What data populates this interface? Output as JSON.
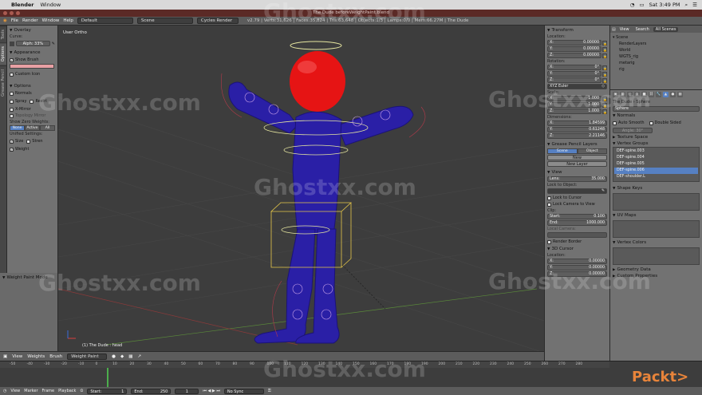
{
  "macos": {
    "app_name": "Blender",
    "menu": [
      "Window"
    ],
    "clock": "Sat 3:49 PM"
  },
  "window": {
    "title": "The Dude beforeWeightPaint.blend"
  },
  "infobar": {
    "menus": [
      "File",
      "Render",
      "Window",
      "Help"
    ],
    "layout": "Default",
    "scene": "Scene",
    "engine": "Cycles Render",
    "stats": "v2.79 | Verts:31,626 | Faces:35,824 | Tris:63,648 | Objects:1/3 | Lamps:0/0 | Mem:66.27M | The Dude"
  },
  "tooltabs": [
    "Tools",
    "Options",
    "Grease Pencil"
  ],
  "shelf": {
    "overlay_head": "Overlay",
    "curve_label": "Curve:",
    "alpha_field": "Alph: 33%",
    "appearance_head": "Appearance",
    "show_brush": "Show Brush",
    "custom_icon": "Custom Icon",
    "options_head": "Options",
    "opt_normals": "Normals",
    "opt_spray": "Spray",
    "opt_restrict": "Restri",
    "opt_xmirror": "X-Mirror",
    "opt_topology": "Topology Mirror",
    "zero_weights": "Show Zero Weights:",
    "zw_none": "None",
    "zw_active": "Active",
    "zw_all": "All",
    "unified": "Unified Settings:",
    "u_size": "Size",
    "u_strength": "Stren",
    "u_weight": "Weight",
    "mode_panel": "Weight Paint Mode"
  },
  "viewport": {
    "label": "User Ortho",
    "object_label": "(1) The Dude : head",
    "header": {
      "view": "View",
      "weights": "Weights",
      "brush": "Brush",
      "mode": "Weight Paint"
    }
  },
  "npanel": {
    "transform": "Transform",
    "location": "Location:",
    "loc": [
      [
        "X:",
        "0.00000"
      ],
      [
        "Y:",
        "0.00000"
      ],
      [
        "Z:",
        "0.00000"
      ]
    ],
    "rotation": "Rotation:",
    "rot": [
      [
        "X:",
        "0°"
      ],
      [
        "Y:",
        "0°"
      ],
      [
        "Z:",
        "0°"
      ]
    ],
    "rot_mode": "XYZ Euler",
    "scale": "Scale:",
    "scl": [
      [
        "X:",
        "1.000"
      ],
      [
        "Y:",
        "1.000"
      ],
      [
        "Z:",
        "1.000"
      ]
    ],
    "dimensions": "Dimensions:",
    "dim": [
      [
        "X:",
        "1.84599"
      ],
      [
        "Y:",
        "0.61248"
      ],
      [
        "Z:",
        "2.21146"
      ]
    ],
    "grease_head": "Grease Pencil Layers",
    "gp_scene": "Scene",
    "gp_object": "Object",
    "gp_new": "New",
    "gp_newlayer": "New Layer",
    "view_head": "View",
    "lens": [
      "Lens:",
      "35.000"
    ],
    "lock_object": "Lock to Object:",
    "lock_cursor": "Lock to Cursor",
    "lock_camera": "Lock Camera to View",
    "clip": "Clip:",
    "clip_start": [
      "Start:",
      "0.100"
    ],
    "clip_end": [
      "End:",
      "1000.000"
    ],
    "local_camera": "Local Camera:",
    "render_border": "Render Border",
    "cursor_head": "3D Cursor",
    "cursor_location": "Location:",
    "cur": [
      [
        "X:",
        "0.00000"
      ],
      [
        "Y:",
        "0.00000"
      ],
      [
        "Z:",
        "0.00000"
      ]
    ]
  },
  "outliner": {
    "tabs": [
      "View",
      "Search",
      "All Scenes"
    ],
    "rows": [
      "Scene",
      "RenderLayers",
      "World",
      "WGTS_rig",
      "metarig",
      "rig"
    ]
  },
  "props": {
    "breadcrumb": [
      "The Dude",
      "Sphere"
    ],
    "mesh_name": "Sphere",
    "normals_head": "Normals",
    "auto_smooth": "Auto Smooth",
    "double_sided": "Double Sided",
    "angle": "Angle:    30°",
    "texture_space": "Texture Space",
    "vgroups_head": "Vertex Groups",
    "vgroups": [
      "DEF-spine.003",
      "DEF-spine.004",
      "DEF-spine.005",
      "DEF-spine.006",
      "DEF-shoulder.L"
    ],
    "shape_keys": "Shape Keys",
    "uv_maps": "UV Maps",
    "vertex_colors": "Vertex Colors",
    "geometry_data": "Geometry Data",
    "custom_props": "Custom Properties"
  },
  "timeline": {
    "ticks": [
      "-50",
      "-40",
      "-30",
      "-20",
      "-10",
      "0",
      "10",
      "20",
      "30",
      "40",
      "50",
      "60",
      "70",
      "80",
      "90",
      "100",
      "110",
      "120",
      "130",
      "140",
      "150",
      "160",
      "170",
      "180",
      "190",
      "200",
      "210",
      "220",
      "230",
      "240",
      "250",
      "260",
      "270",
      "280"
    ],
    "footer": {
      "view": "View",
      "marker": "Marker",
      "frame": "Frame",
      "playback": "Playback",
      "start": "Start:",
      "start_val": "1",
      "end": "End:",
      "end_val": "250",
      "current": "1",
      "sync": "No Sync"
    }
  },
  "watermark": "Ghostxx.com",
  "brand": "Packt>"
}
